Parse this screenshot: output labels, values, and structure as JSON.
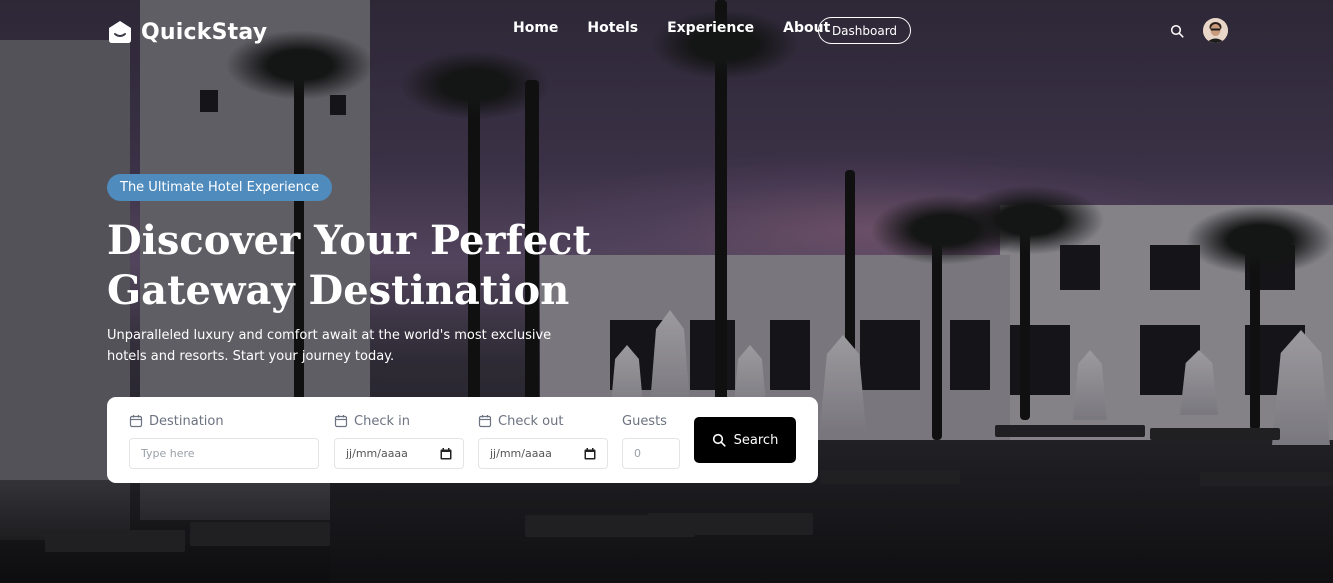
{
  "brand": {
    "name": "QuickStay"
  },
  "nav": {
    "links": [
      "Home",
      "Hotels",
      "Experience",
      "About"
    ],
    "dashboard_label": "Dashboard"
  },
  "hero": {
    "badge": "The Ultimate Hotel Experience",
    "headline": "Discover Your Perfect Gateway Destination",
    "subtext": "Unparalleled luxury and comfort await at the world's most exclusive hotels and resorts. Start your journey today."
  },
  "search_form": {
    "destination": {
      "label": "Destination",
      "placeholder": "Type here"
    },
    "checkin": {
      "label": "Check in",
      "value": "jj/mm/aaaa"
    },
    "checkout": {
      "label": "Check out",
      "value": "jj/mm/aaaa"
    },
    "guests": {
      "label": "Guests",
      "placeholder": "0"
    },
    "search_label": "Search"
  },
  "colors": {
    "badge_bg": "#4f8bbd",
    "form_bg": "#ffffff",
    "search_button_bg": "#000000"
  },
  "icons": [
    "logo-icon",
    "search-icon",
    "avatar",
    "calendar-icon"
  ]
}
